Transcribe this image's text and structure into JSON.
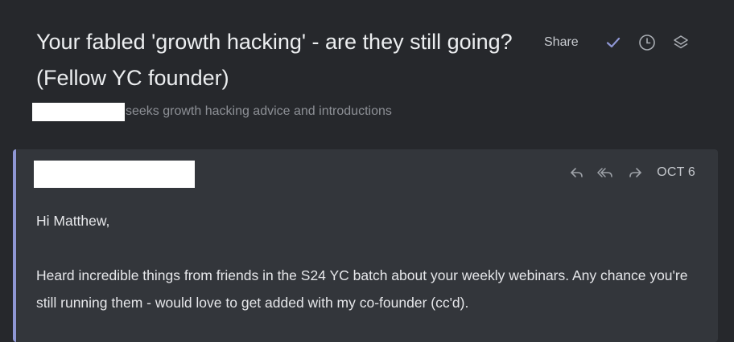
{
  "thread": {
    "subject": "Your fabled 'growth hacking' - are they still going? (Fellow YC founder)",
    "summary": "seeks growth hacking advice and introductions"
  },
  "toolbar": {
    "share_label": "Share",
    "icons": [
      "check-icon",
      "clock-icon",
      "layers-icon"
    ]
  },
  "email": {
    "date": "OCT 6",
    "actions": [
      "reply-icon",
      "reply-all-icon",
      "forward-icon"
    ],
    "greeting": "Hi Matthew,",
    "body": "Heard incredible things from friends in the S24 YC batch about your weekly webinars. Any chance you're still running them - would love to get added with my co-founder (cc'd)."
  },
  "colors": {
    "background": "#26282c",
    "card": "#33363b",
    "accent": "#8f97d4",
    "check": "#8f97d4"
  }
}
